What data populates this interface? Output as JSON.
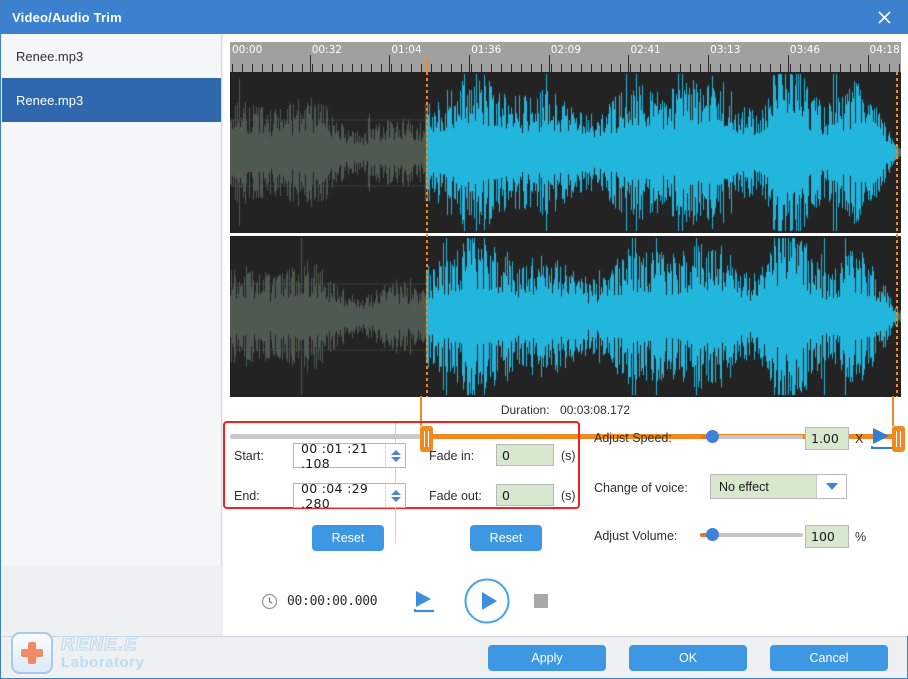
{
  "window": {
    "title": "Video/Audio Trim",
    "close_icon": "close-icon"
  },
  "sidebar": {
    "items": [
      {
        "label": "Renee.mp3",
        "selected": false
      },
      {
        "label": "Renee.mp3",
        "selected": true
      }
    ]
  },
  "timeline": {
    "tick_labels": [
      "00:00",
      "00:32",
      "01:04",
      "01:36",
      "02:09",
      "02:41",
      "03:13",
      "03:46",
      "04:18"
    ],
    "cursor_position_pct": 29.2,
    "selection_start_pct": 29.2,
    "selection_end_pct": 99.5,
    "duration_label": "Duration:",
    "duration_value": "00:03:08.172"
  },
  "trim": {
    "start_label": "Start:",
    "start_value": "00 :01 :21 .108",
    "end_label": "End:",
    "end_value": "00 :04 :29 .280",
    "fade_in_label": "Fade in:",
    "fade_in_value": "0",
    "fade_out_label": "Fade out:",
    "fade_out_value": "0",
    "seconds_unit": "(s)",
    "reset_left_label": "Reset",
    "reset_right_label": "Reset"
  },
  "effects": {
    "speed_label": "Adjust Speed:",
    "speed_value": "1.00",
    "speed_unit": "X",
    "speed_slider_pct": 9,
    "preview_icon": "play-preview-icon",
    "voice_label": "Change of voice:",
    "voice_value": "No effect",
    "voice_options": [
      "No effect"
    ],
    "volume_label": "Adjust Volume:",
    "volume_value": "100",
    "volume_unit": "%",
    "volume_slider_pct": 9
  },
  "transport": {
    "clock_icon": "clock-icon",
    "time_code": "00:00:00.000",
    "play_from_start_icon": "play-from-start-icon",
    "play_icon": "play-icon",
    "stop_icon": "stop-icon"
  },
  "footer": {
    "apply_label": "Apply",
    "ok_label": "OK",
    "cancel_label": "Cancel"
  },
  "watermark": {
    "line1": "RENE.E",
    "line2": "Laboratory"
  },
  "colors": {
    "title_bar": "#3b81cf",
    "accent_blue": "#3d97e3",
    "selected_item": "#3068b0",
    "trim_orange": "#f08a1e",
    "waveform_selected": "#22b6dd",
    "waveform_dim": "#5f6f62",
    "field_green": "#d7e8cf",
    "highlight_red": "#f02121"
  }
}
